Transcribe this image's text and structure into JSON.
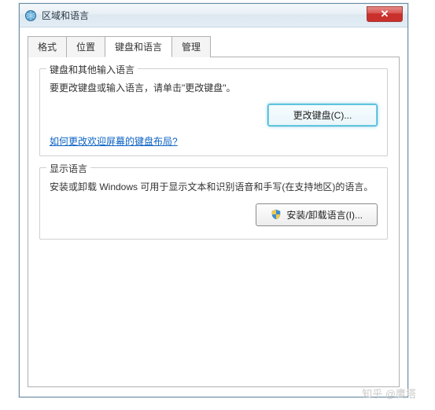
{
  "window": {
    "title": "区域和语言",
    "close_label": "✕"
  },
  "tabs": [
    {
      "label": "格式"
    },
    {
      "label": "位置"
    },
    {
      "label": "键盘和语言"
    },
    {
      "label": "管理"
    }
  ],
  "active_tab_index": 2,
  "group_keyboard": {
    "title": "键盘和其他输入语言",
    "desc": "要更改键盘或输入语言，请单击\"更改键盘\"。",
    "change_button": "更改键盘(C)...",
    "welcome_link": "如何更改欢迎屏幕的键盘布局?"
  },
  "group_display": {
    "title": "显示语言",
    "desc": "安装或卸载 Windows 可用于显示文本和识别语音和手写(在支持地区)的语言。",
    "install_button": "安装/卸载语言(I)..."
  },
  "watermark": "知乎 @鹰塔"
}
